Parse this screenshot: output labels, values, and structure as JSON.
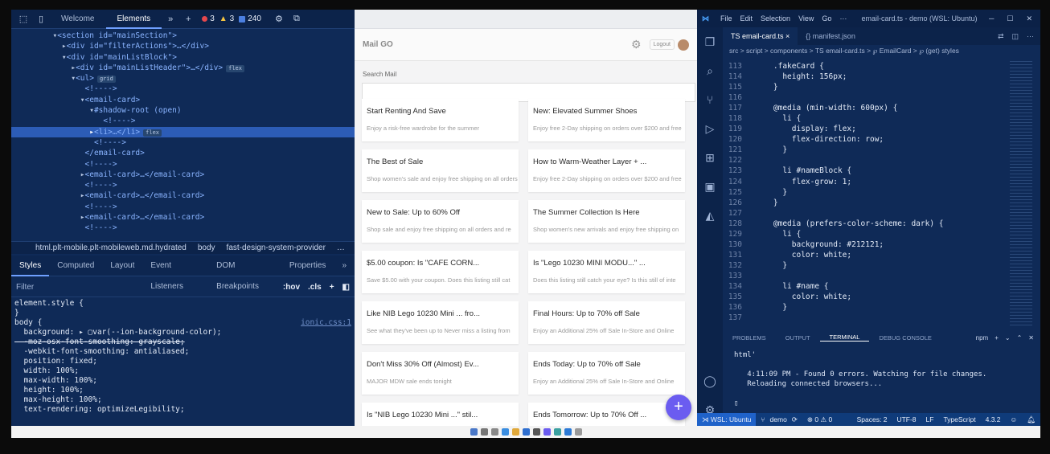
{
  "devtools": {
    "tabs": [
      "Welcome",
      "Elements"
    ],
    "active_tab": "Elements",
    "errors": "3",
    "warnings": "3",
    "info": "240",
    "dom": [
      {
        "indent": "      ",
        "text": "<section id=\"mainSection\">"
      },
      {
        "indent": "        ",
        "text": "<div id=\"filterActions\">…</div>"
      },
      {
        "indent": "        ",
        "text": "<div id=\"mainListBlock\">"
      },
      {
        "indent": "          ",
        "text": "<div id=\"mainListHeader\">…</div>",
        "pill": "flex"
      },
      {
        "indent": "          ",
        "text": "<ul>",
        "pill": "grid"
      },
      {
        "indent": "            ",
        "text": "<!---->"
      },
      {
        "indent": "            ",
        "text": "<email-card>"
      },
      {
        "indent": "              ",
        "text": "#shadow-root (open)"
      },
      {
        "indent": "                ",
        "text": "<!---->"
      },
      {
        "indent": "              ",
        "text": "<li>…</li>",
        "pill": "flex",
        "selected": true
      },
      {
        "indent": "              ",
        "text": "<!---->"
      },
      {
        "indent": "            ",
        "text": "</email-card>"
      },
      {
        "indent": "            ",
        "text": "<!---->"
      },
      {
        "indent": "            ",
        "text": "<email-card>…</email-card>"
      },
      {
        "indent": "            ",
        "text": "<!---->"
      },
      {
        "indent": "            ",
        "text": "<email-card>…</email-card>"
      },
      {
        "indent": "            ",
        "text": "<!---->"
      },
      {
        "indent": "            ",
        "text": "<email-card>…</email-card>"
      },
      {
        "indent": "            ",
        "text": "<!---->"
      }
    ],
    "breadcrumb": [
      "html.plt-mobile.plt-mobileweb.md.hydrated",
      "body",
      "fast-design-system-provider",
      "…"
    ],
    "subtabs": [
      "Styles",
      "Computed",
      "Layout",
      "Event Listeners",
      "DOM Breakpoints",
      "Properties"
    ],
    "active_subtab": "Styles",
    "filter_placeholder": "Filter",
    "filter_hov": ":hov",
    "filter_cls": ".cls",
    "styles": [
      "element.style {",
      "}",
      "body {",
      "  background: ▸ ▢var(--ion-background-color);",
      "  -moz-osx-font-smoothing: grayscale;",
      "  -webkit-font-smoothing: antialiased;",
      "  position: fixed;",
      "  width: 100%;",
      "  max-width: 100%;",
      "  height: 100%;",
      "  max-height: 100%;",
      "  text-rendering: optimizeLegibility;"
    ],
    "styles_source": "ionic.css:1"
  },
  "app": {
    "title": "Mail GO",
    "logout": "Logout",
    "search_label": "Search Mail",
    "cards": [
      {
        "title": "Start Renting And Save",
        "sub": "Enjoy a risk-free wardrobe for the summer"
      },
      {
        "title": "New: Elevated Summer Shoes",
        "sub": "Enjoy free 2-Day shipping on orders over $200 and free"
      },
      {
        "title": "The Best of Sale",
        "sub": "Shop women's sale and enjoy free shipping on all orders"
      },
      {
        "title": "How to Warm-Weather Layer + ...",
        "sub": "Enjoy free 2-Day shipping on orders over $200 and free"
      },
      {
        "title": "New to Sale: Up to 60% Off",
        "sub": "Shop sale and enjoy free shipping on all orders and re"
      },
      {
        "title": "The Summer Collection Is Here",
        "sub": "Shop women's new arrivals and enjoy free shipping on"
      },
      {
        "title": "$5.00 coupon: Is \"CAFE CORN...",
        "sub": "Save $5.00 with your coupon. Does this listing still cat"
      },
      {
        "title": "Is \"Lego 10230 MINI MODU...\" ...",
        "sub": "Does this listing still catch your eye? Is this still of inte"
      },
      {
        "title": "Like NIB Lego 10230 Mini ... fro...",
        "sub": "See what they've been up to Never miss a listing from"
      },
      {
        "title": "Final Hours: Up to 70% off Sale",
        "sub": "Enjoy an Additional 25% off Sale In-Store and Online"
      },
      {
        "title": "Don't Miss 30% Off (Almost) Ev...",
        "sub": "MAJOR MDW sale ends tonight"
      },
      {
        "title": "Ends Today: Up to 70% off Sale",
        "sub": "Enjoy an Additional 25% off Sale In-Store and Online"
      },
      {
        "title": "Is \"NIB Lego 10230 Mini ...\" stil...",
        "sub": ""
      },
      {
        "title": "Ends Tomorrow: Up to 70% Off ...",
        "sub": ""
      }
    ],
    "fab": "+"
  },
  "vscode": {
    "menu": [
      "File",
      "Edit",
      "Selection",
      "View",
      "Go",
      "···"
    ],
    "window_title": "email-card.ts - demo (WSL: Ubuntu)",
    "tabs": [
      "TS email-card.ts ×",
      "{} manifest.json"
    ],
    "breadcrumb": "src > script > components > TS email-card.ts > ℘ EmailCard > ℘ (get) styles",
    "code": [
      {
        "n": "113",
        "t": "    .fakeCard {"
      },
      {
        "n": "114",
        "t": "      height: 156px;"
      },
      {
        "n": "115",
        "t": "    }"
      },
      {
        "n": "116",
        "t": ""
      },
      {
        "n": "117",
        "t": "    @media (min-width: 600px) {"
      },
      {
        "n": "118",
        "t": "      li {"
      },
      {
        "n": "119",
        "t": "        display: flex;"
      },
      {
        "n": "120",
        "t": "        flex-direction: row;"
      },
      {
        "n": "121",
        "t": "      }"
      },
      {
        "n": "122",
        "t": ""
      },
      {
        "n": "123",
        "t": "      li #nameBlock {"
      },
      {
        "n": "124",
        "t": "        flex-grow: 1;"
      },
      {
        "n": "125",
        "t": "      }"
      },
      {
        "n": "126",
        "t": "    }"
      },
      {
        "n": "127",
        "t": ""
      },
      {
        "n": "128",
        "t": "    @media (prefers-color-scheme: dark) {"
      },
      {
        "n": "129",
        "t": "      li {"
      },
      {
        "n": "130",
        "t": "        background: #212121;"
      },
      {
        "n": "131",
        "t": "        color: white;"
      },
      {
        "n": "132",
        "t": "      }"
      },
      {
        "n": "133",
        "t": ""
      },
      {
        "n": "134",
        "t": "      li #name {"
      },
      {
        "n": "135",
        "t": "        color: white;"
      },
      {
        "n": "136",
        "t": "      }"
      },
      {
        "n": "137",
        "t": ""
      }
    ],
    "panel_tabs": [
      "PROBLEMS",
      "OUTPUT",
      "TERMINAL",
      "DEBUG CONSOLE"
    ],
    "active_panel": "TERMINAL",
    "terminal_shell": "npm",
    "terminal": [
      "html'",
      "",
      "   4:11:09 PM - Found 0 errors. Watching for file changes.",
      "   Reloading connected browsers...",
      "",
      "▯"
    ],
    "status": {
      "remote": "⋊ WSL: Ubuntu",
      "branch": "demo",
      "problems": "⊗ 0 ⚠ 0",
      "spaces": "Spaces: 2",
      "encoding": "UTF-8",
      "eol": "LF",
      "language": "TypeScript",
      "version": "4.3.2"
    }
  }
}
